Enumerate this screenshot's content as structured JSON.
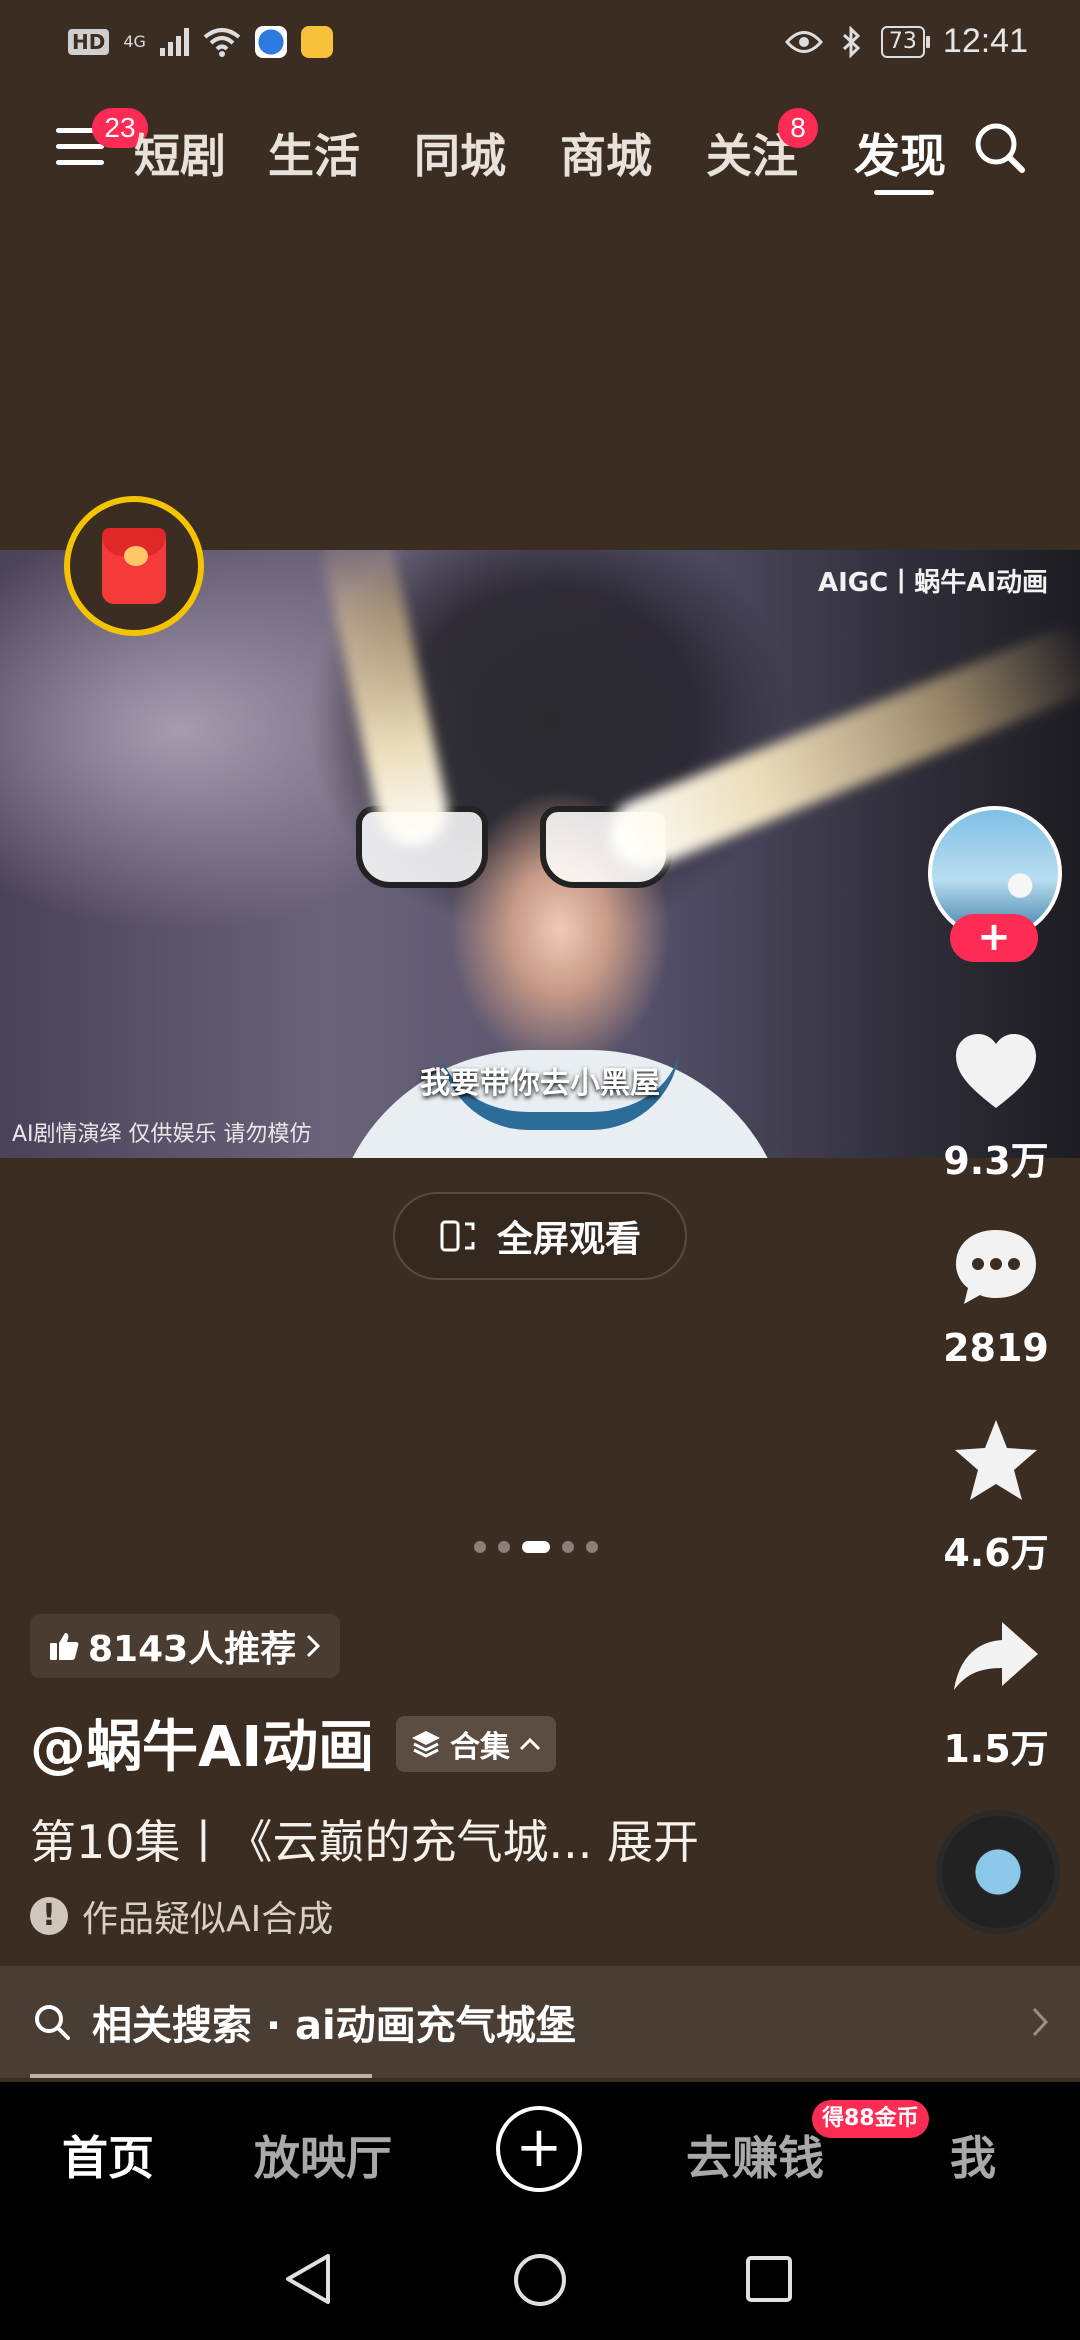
{
  "status_bar": {
    "hd": "HD",
    "network": "4G",
    "battery": "73",
    "time": "12:41"
  },
  "top_nav": {
    "menu_badge": "23",
    "tabs": [
      {
        "label": "短剧",
        "active": false
      },
      {
        "label": "生活",
        "active": false
      },
      {
        "label": "同城",
        "active": false
      },
      {
        "label": "商城",
        "active": false
      },
      {
        "label": "关注",
        "active": false
      },
      {
        "label": "发现",
        "active": true
      }
    ],
    "follow_badge": "8"
  },
  "video": {
    "watermark": "AIGC丨蜗牛AI动画",
    "subtitle": "我要带你去小黑屋",
    "disclaimer": "AI剧情演绎 仅供娱乐 请勿模仿"
  },
  "actions": {
    "likes": "9.3万",
    "comments": "2819",
    "favorites": "4.6万",
    "shares": "1.5万",
    "follow_symbol": "+"
  },
  "fullscreen_label": "全屏观看",
  "carousel": {
    "count": 5,
    "active_index": 2
  },
  "info": {
    "recommend": "8143人推荐",
    "author": "@蜗牛AI动画",
    "collection": "合集",
    "description": "第10集丨《云巅的充气城... 展开",
    "ai_note": "作品疑似AI合成",
    "ai_note_symbol": "!"
  },
  "related_search": "相关搜索 · ai动画充气城堡",
  "bottom_nav": {
    "home": "首页",
    "theater": "放映厅",
    "plus": "+",
    "earn": "去赚钱",
    "earn_badge": "得88金币",
    "me": "我"
  },
  "colors": {
    "background": "#3b2d22",
    "accent": "#fe2c55",
    "red_packet_ring": "#f5c400"
  }
}
